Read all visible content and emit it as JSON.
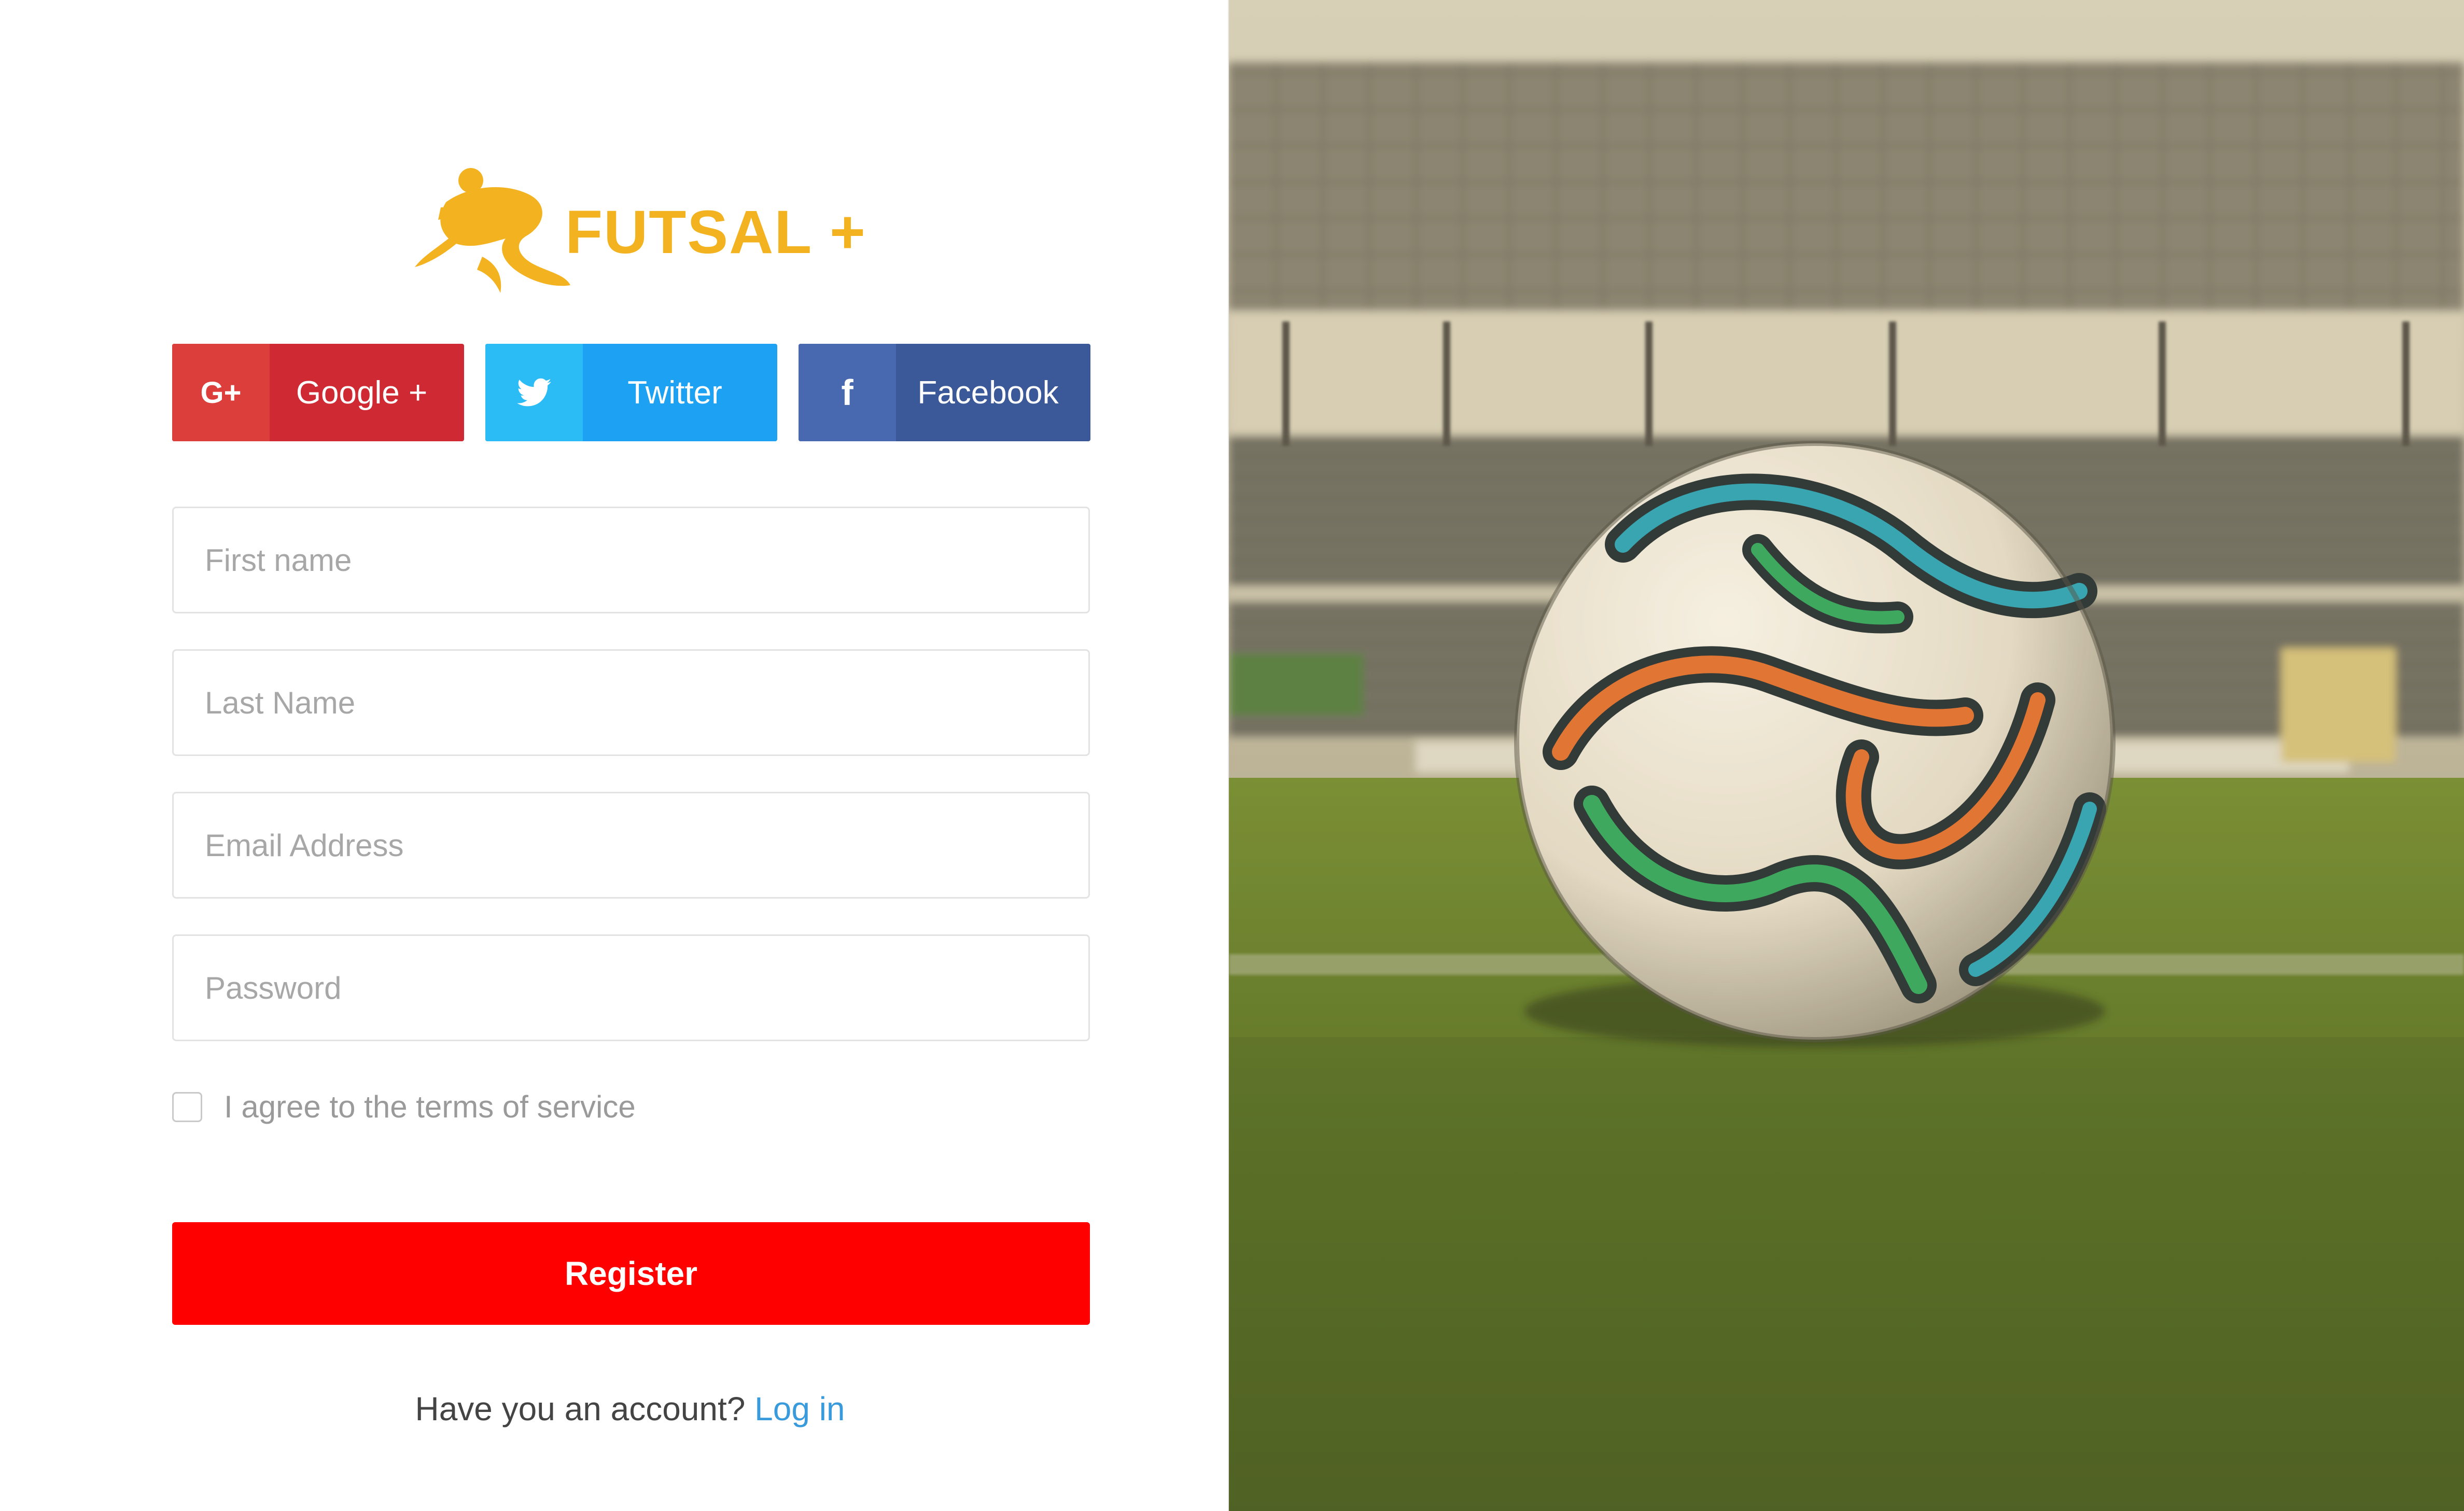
{
  "brand": {
    "name": "FUTSAL +",
    "logo_color": "#f3b21f"
  },
  "social": {
    "google": {
      "label": "Google +",
      "icon": "google-plus-icon",
      "icon_text": "G+",
      "color": "#cf2a33"
    },
    "twitter": {
      "label": "Twitter",
      "icon": "twitter-bird-icon",
      "color": "#1da1f2"
    },
    "facebook": {
      "label": "Facebook",
      "icon": "facebook-f-icon",
      "icon_text": "f",
      "color": "#3b5998"
    }
  },
  "form": {
    "first_name": {
      "placeholder": "First name",
      "value": ""
    },
    "last_name": {
      "placeholder": "Last Name",
      "value": ""
    },
    "email": {
      "placeholder": "Email Address",
      "value": ""
    },
    "password": {
      "placeholder": "Password",
      "value": ""
    },
    "terms_label": "I agree to the terms of service",
    "terms_checked": false,
    "register_label": "Register",
    "register_color": "#fe0000"
  },
  "footer": {
    "prompt": "Have you an account?",
    "login_label": "Log in",
    "link_color": "#3a9bdc"
  }
}
